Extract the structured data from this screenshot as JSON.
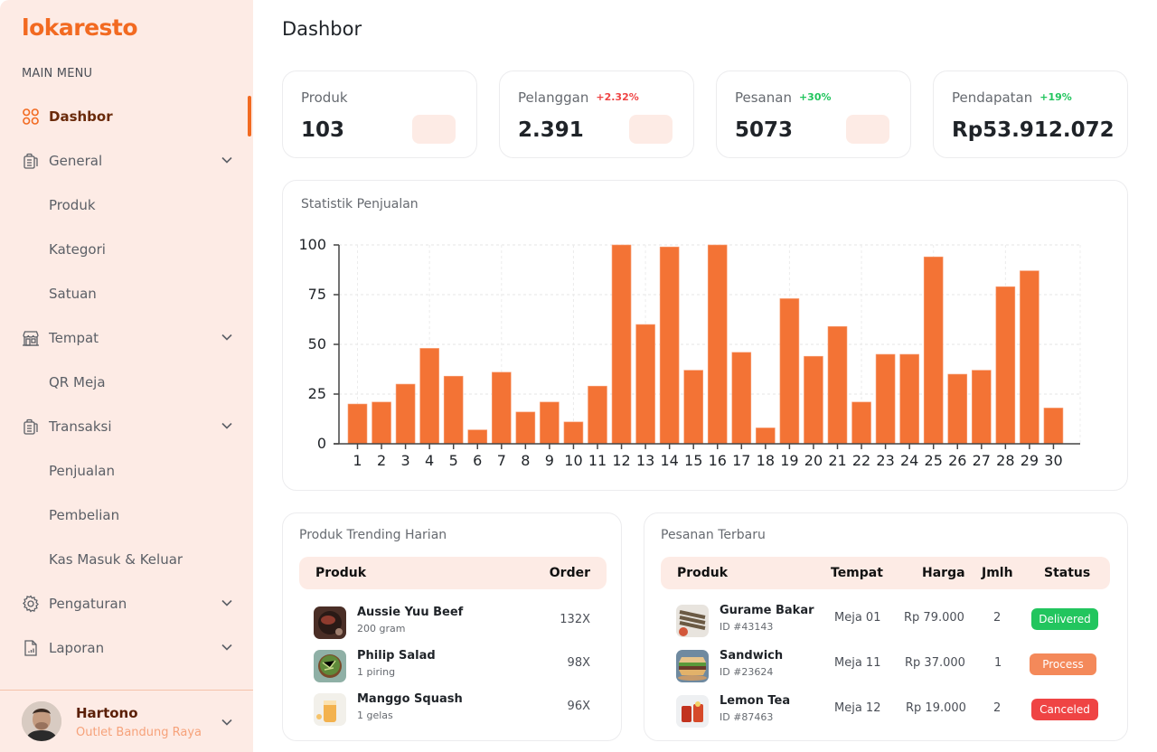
{
  "brand": {
    "name": "lokaresto",
    "color": "#f26a21"
  },
  "sidebar": {
    "menu_label": "MAIN MENU",
    "items": [
      {
        "label": "Dashbor",
        "icon": "grid-icon",
        "active": true
      },
      {
        "label": "General",
        "icon": "clipboard-icon",
        "expandable": true
      },
      {
        "label": "Produk",
        "sub": true
      },
      {
        "label": "Kategori",
        "sub": true
      },
      {
        "label": "Satuan",
        "sub": true
      },
      {
        "label": "Tempat",
        "icon": "store-icon",
        "expandable": true
      },
      {
        "label": "QR Meja",
        "sub": true
      },
      {
        "label": "Transaksi",
        "icon": "clipboard-icon",
        "expandable": true
      },
      {
        "label": "Penjualan",
        "sub": true
      },
      {
        "label": "Pembelian",
        "sub": true
      },
      {
        "label": "Kas Masuk & Keluar",
        "sub": true
      },
      {
        "label": "Pengaturan",
        "icon": "gear-icon",
        "expandable": true
      },
      {
        "label": "Laporan",
        "icon": "report-file-icon",
        "expandable": true
      }
    ],
    "user": {
      "name": "Hartono",
      "outlet": "Outlet Bandung Raya"
    }
  },
  "header": {
    "title": "Dashbor"
  },
  "stats": [
    {
      "label": "Produk",
      "value": "103",
      "delta": "",
      "delta_color": "",
      "has_icon_box": true
    },
    {
      "label": "Pelanggan",
      "value": "2.391",
      "delta": "+2.32%",
      "delta_color": "#ef4444",
      "has_icon_box": true
    },
    {
      "label": "Pesanan",
      "value": "5073",
      "delta": "+30%",
      "delta_color": "#22c55e",
      "has_icon_box": true
    },
    {
      "label": "Pendapatan",
      "value": "Rp53.912.072",
      "delta": "+19%",
      "delta_color": "#22c55e",
      "has_icon_box": false
    }
  ],
  "chart_data": {
    "type": "bar",
    "title": "Statistik Penjualan",
    "xlabel": "",
    "ylabel": "",
    "categories": [
      "1",
      "2",
      "3",
      "4",
      "5",
      "6",
      "7",
      "8",
      "9",
      "10",
      "11",
      "12",
      "13",
      "14",
      "15",
      "16",
      "17",
      "18",
      "19",
      "20",
      "21",
      "22",
      "23",
      "24",
      "25",
      "26",
      "27",
      "28",
      "29",
      "30"
    ],
    "values": [
      20,
      21,
      30,
      48,
      34,
      7,
      36,
      16,
      21,
      11,
      29,
      100,
      60,
      99,
      37,
      100,
      46,
      8,
      73,
      44,
      59,
      21,
      45,
      45,
      94,
      35,
      37,
      79,
      87,
      18
    ],
    "ylim": [
      0,
      100
    ],
    "yticks": [
      0,
      25,
      50,
      75,
      100
    ],
    "grid": true,
    "bar_color": "#f37335"
  },
  "trending": {
    "title": "Produk Trending Harian",
    "columns": [
      "Produk",
      "Order"
    ],
    "rows": [
      {
        "name": "Aussie Yuu Beef",
        "unit": "200 gram",
        "order": "132X",
        "thumb": "beef"
      },
      {
        "name": "Philip Salad",
        "unit": "1 piring",
        "order": "98X",
        "thumb": "salad"
      },
      {
        "name": "Manggo Squash",
        "unit": "1 gelas",
        "order": "96X",
        "thumb": "juice"
      }
    ]
  },
  "recent_orders": {
    "title": "Pesanan Terbaru",
    "columns": [
      "Produk",
      "Tempat",
      "Harga",
      "Jmlh",
      "Status"
    ],
    "rows": [
      {
        "name": "Gurame Bakar",
        "id": "ID #43143",
        "place": "Meja 01",
        "price": "Rp 79.000",
        "qty": "2",
        "status": "Delivered",
        "status_color": "#22c55e",
        "thumb": "fish"
      },
      {
        "name": "Sandwich",
        "id": "ID #23624",
        "place": "Meja 11",
        "price": "Rp 37.000",
        "qty": "1",
        "status": "Process",
        "status_color": "#f4895a",
        "thumb": "sandwich"
      },
      {
        "name": "Lemon Tea",
        "id": "ID #87463",
        "place": "Meja 12",
        "price": "Rp 19.000",
        "qty": "2",
        "status": "Canceled",
        "status_color": "#ef4444",
        "thumb": "tea"
      }
    ]
  }
}
